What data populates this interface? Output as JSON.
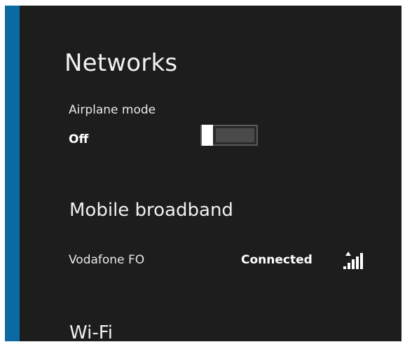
{
  "panel": {
    "title": "Networks"
  },
  "airplane_mode": {
    "label": "Airplane mode",
    "state": "Off"
  },
  "mobile_broadband": {
    "heading": "Mobile broadband",
    "network": {
      "name": "Vodafone FO",
      "status": "Connected",
      "signal_icon": "cellular-signal-icon"
    }
  },
  "wifi": {
    "heading": "Wi-Fi"
  },
  "colors": {
    "panel_background": "#1d1d1d",
    "accent": "#0a6aa1",
    "text": "#ffffff"
  }
}
